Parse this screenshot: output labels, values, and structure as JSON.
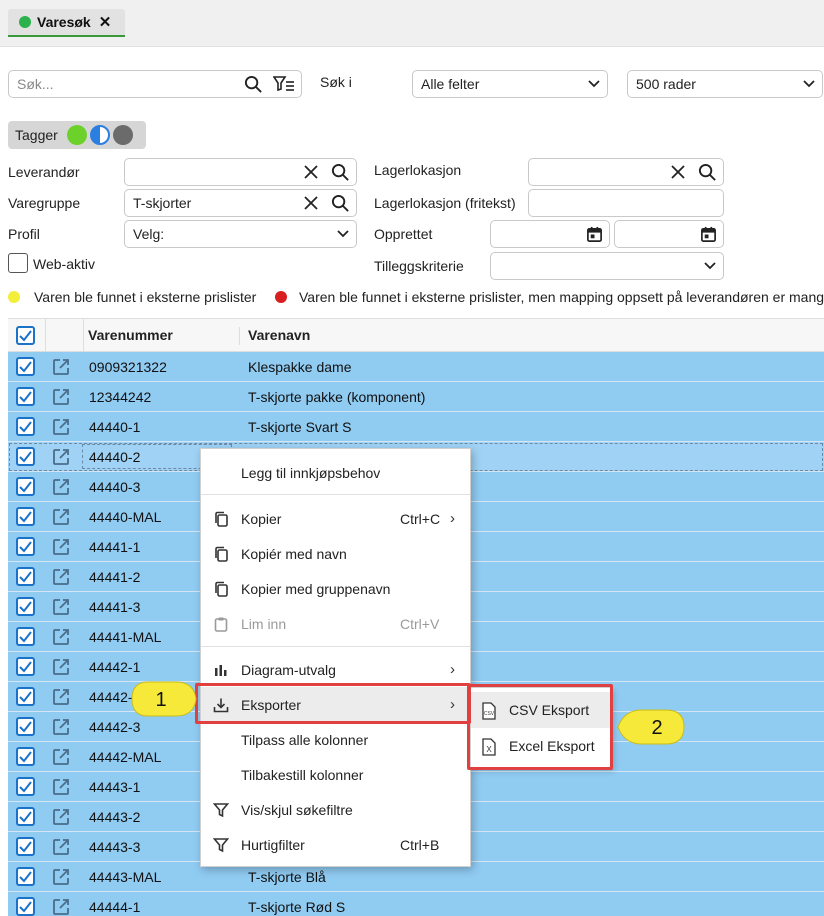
{
  "tab": {
    "title": "Varesøk",
    "close": "✕"
  },
  "search": {
    "placeholder": "Søk...",
    "label": "Søk i",
    "field_select": "Alle felter",
    "rows_select": "500 rader"
  },
  "tagger": {
    "label": "Tagger",
    "dots": [
      "#6cd12a",
      "#2b7fe0",
      "#6b6b6b"
    ]
  },
  "filters": {
    "leverandor": {
      "label": "Leverandør",
      "value": ""
    },
    "varegruppe": {
      "label": "Varegruppe",
      "value": "T-skjorter"
    },
    "profil": {
      "label": "Profil",
      "value": "Velg:"
    },
    "webaktiv": {
      "label": "Web-aktiv"
    },
    "lagerlokasjon": {
      "label": "Lagerlokasjon",
      "value": ""
    },
    "lagerlokasjon_fritekst": {
      "label": "Lagerlokasjon (fritekst)",
      "value": ""
    },
    "opprettet": {
      "label": "Opprettet"
    },
    "tilleggskriterie": {
      "label": "Tilleggskriterie",
      "value": ""
    }
  },
  "legend": {
    "yellow": {
      "color": "#f2ee3a",
      "text": "Varen ble funnet i eksterne prislister"
    },
    "red": {
      "color": "#d81f1f",
      "text": "Varen ble funnet i eksterne prislister, men mapping oppsett på leverandøren er mang"
    }
  },
  "grid": {
    "columns": [
      "Varenummer",
      "Varenavn"
    ],
    "rows": [
      {
        "num": "0909321322",
        "name": "Klespakke dame"
      },
      {
        "num": "12344242",
        "name": "T-skjorte pakke (komponent)"
      },
      {
        "num": "44440-1",
        "name": "T-skjorte Svart S"
      },
      {
        "num": "44440-2",
        "name": ""
      },
      {
        "num": "44440-3",
        "name": ""
      },
      {
        "num": "44440-MAL",
        "name": ""
      },
      {
        "num": "44441-1",
        "name": ""
      },
      {
        "num": "44441-2",
        "name": ""
      },
      {
        "num": "44441-3",
        "name": ""
      },
      {
        "num": "44441-MAL",
        "name": ""
      },
      {
        "num": "44442-1",
        "name": ""
      },
      {
        "num": "44442-2",
        "name": ""
      },
      {
        "num": "44442-3",
        "name": ""
      },
      {
        "num": "44442-MAL",
        "name": ""
      },
      {
        "num": "44443-1",
        "name": ""
      },
      {
        "num": "44443-2",
        "name": ""
      },
      {
        "num": "44443-3",
        "name": ""
      },
      {
        "num": "44443-MAL",
        "name": "T-skjorte Blå"
      },
      {
        "num": "44444-1",
        "name": "T-skjorte Rød S"
      }
    ]
  },
  "context_menu": {
    "items": [
      {
        "label": "Legg til innkjøpsbehov",
        "icon": ""
      },
      {
        "label": "Kopier",
        "shortcut": "Ctrl+C",
        "icon": "copy-icon",
        "submenu": "›"
      },
      {
        "label": "Kopiér med navn",
        "icon": "copy-icon"
      },
      {
        "label": "Kopier med gruppenavn",
        "icon": "copy-icon"
      },
      {
        "label": "Lim inn",
        "shortcut": "Ctrl+V",
        "icon": "paste-icon"
      },
      {
        "label": "Diagram-utvalg",
        "icon": "bar-chart-icon",
        "submenu": "›"
      },
      {
        "label": "Eksporter",
        "icon": "download-icon",
        "submenu": "›"
      },
      {
        "label": "Tilpass alle kolonner",
        "icon": ""
      },
      {
        "label": "Tilbakestill kolonner",
        "icon": ""
      },
      {
        "label": "Vis/skjul søkefiltre",
        "icon": "filter-icon"
      },
      {
        "label": "Hurtigfilter",
        "shortcut": "Ctrl+B",
        "icon": "filter-icon"
      }
    ],
    "export_submenu": [
      {
        "label": "CSV Eksport",
        "icon": "csv-file-icon",
        "icon_text": "CSV"
      },
      {
        "label": "Excel Eksport",
        "icon": "excel-file-icon",
        "icon_text": "X"
      }
    ]
  },
  "callouts": {
    "one": "1",
    "two": "2",
    "fill": "#f6e93a"
  }
}
